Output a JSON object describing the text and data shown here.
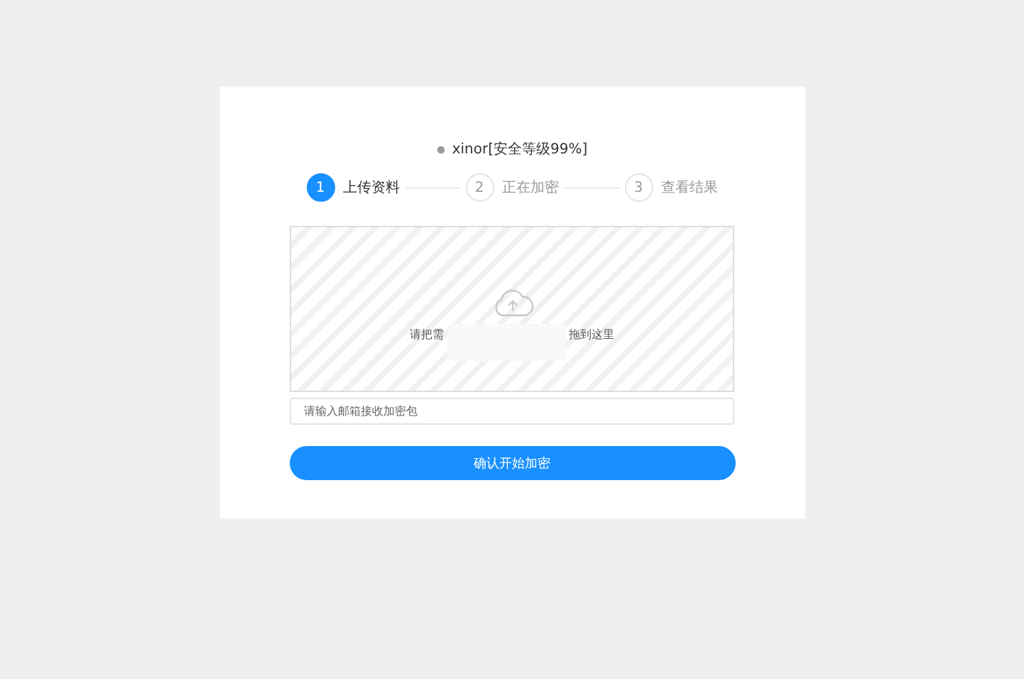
{
  "title": "xinor[安全等级99%]",
  "steps": [
    {
      "number": "1",
      "label": "上传资料",
      "selected": true
    },
    {
      "number": "2",
      "label": "正在加密",
      "selected": false
    },
    {
      "number": "3",
      "label": "查看结果",
      "selected": false
    }
  ],
  "dropzone": {
    "hint_start": "请把需",
    "hint_end": "拖到这里"
  },
  "email": {
    "placeholder": "请输入邮箱接收加密包"
  },
  "submit": "确认开始加密"
}
